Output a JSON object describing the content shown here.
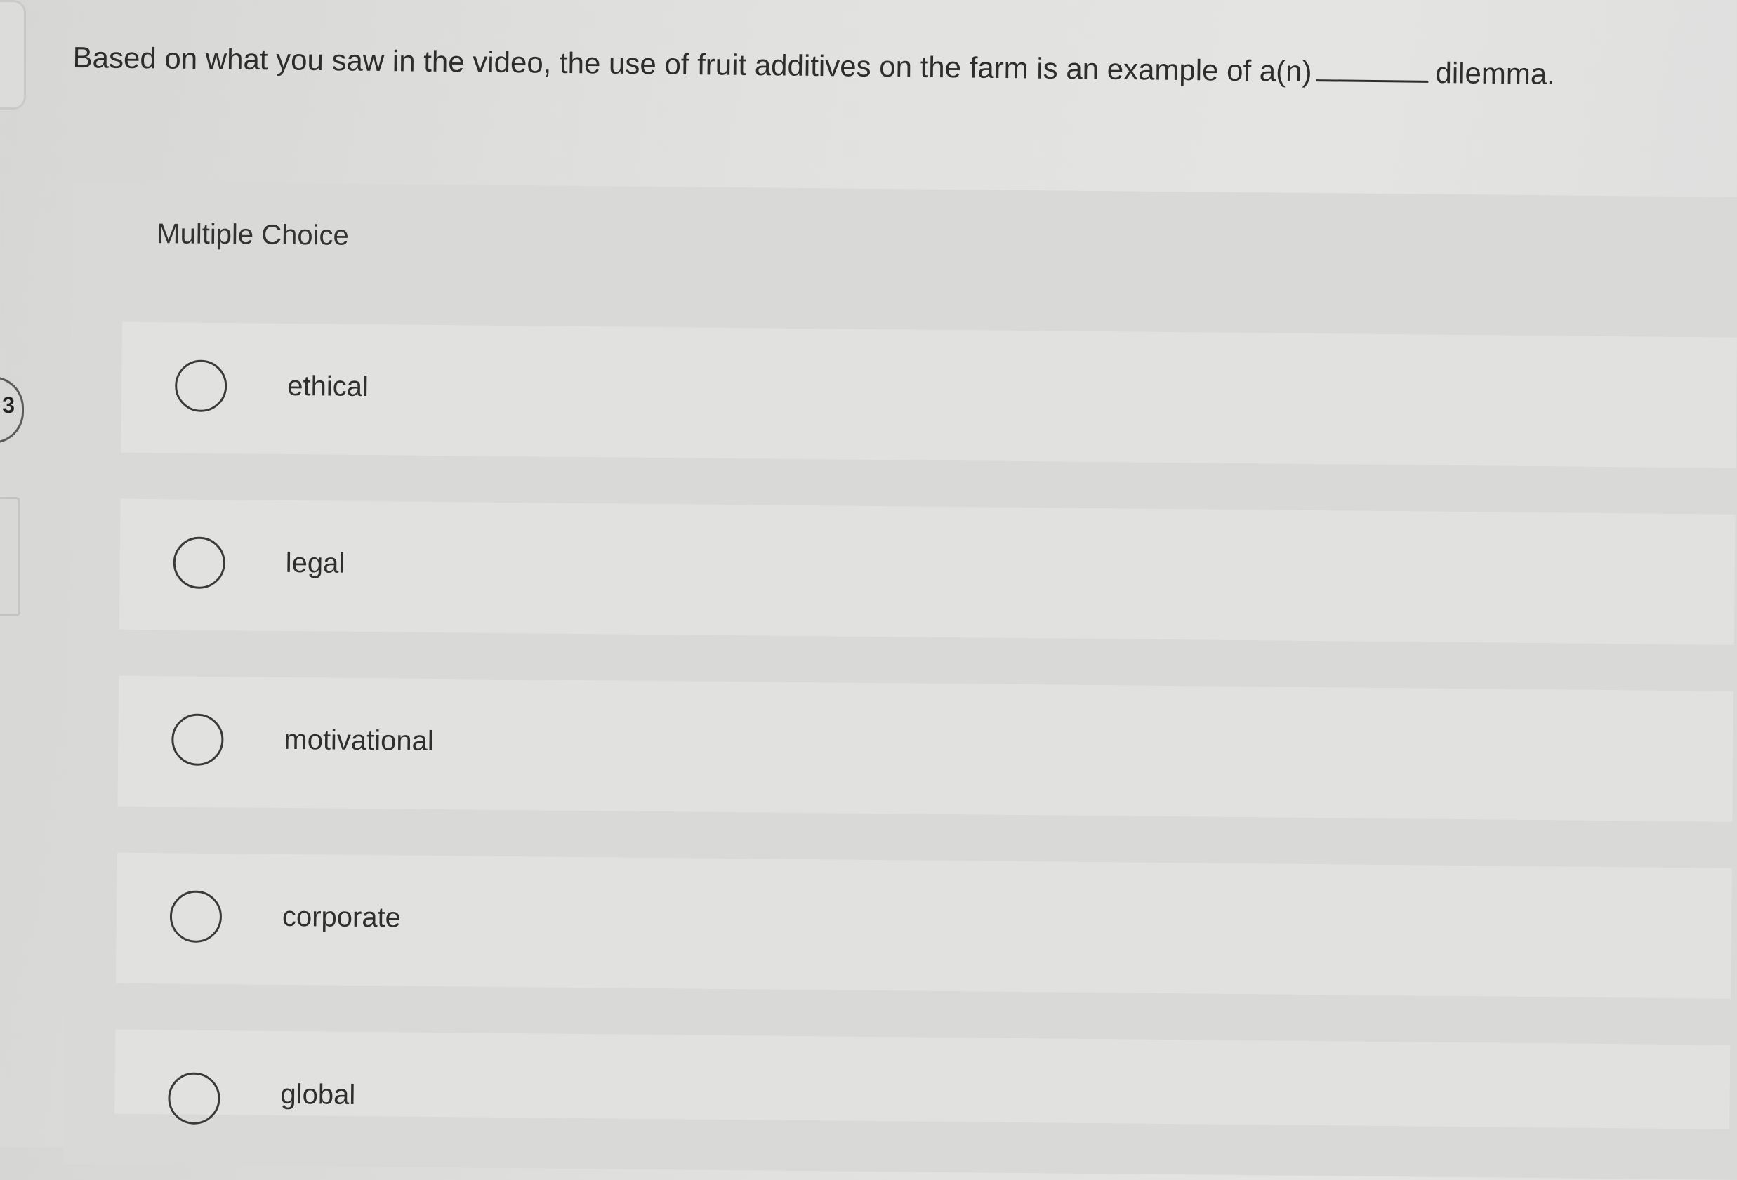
{
  "question": {
    "text_before": "Based on what you saw in the video, the use of fruit additives on the farm is an example of a(n)",
    "text_after": "dilemma."
  },
  "multiple_choice": {
    "header": "Multiple Choice",
    "options": [
      {
        "label": "ethical"
      },
      {
        "label": "legal"
      },
      {
        "label": "motivational"
      },
      {
        "label": "corporate"
      },
      {
        "label": "global"
      }
    ]
  },
  "sidebar": {
    "badge_text": "3"
  }
}
